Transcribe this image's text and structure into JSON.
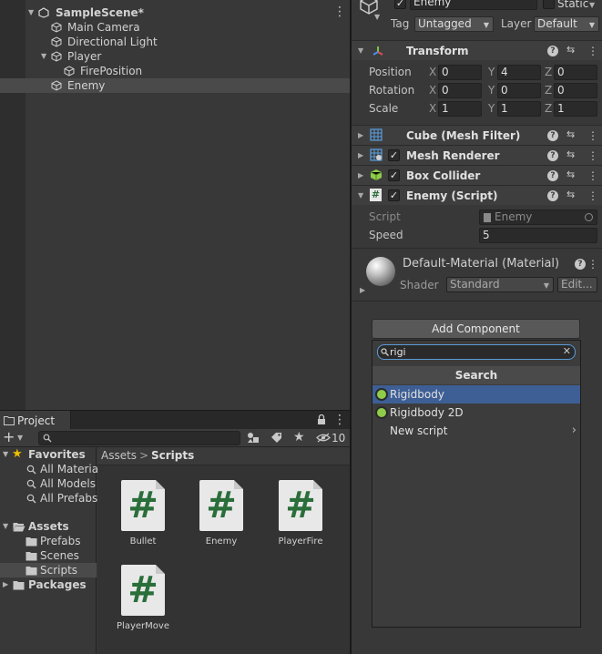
{
  "hierarchy": {
    "scene_name": "SampleScene*",
    "items": [
      {
        "label": "Main Camera"
      },
      {
        "label": "Directional Light"
      },
      {
        "label": "Player"
      },
      {
        "label": "FirePosition"
      },
      {
        "label": "Enemy"
      }
    ]
  },
  "project": {
    "tab_label": "Project",
    "hidden_count": "10",
    "search_placeholder": "",
    "tree": {
      "favorites": "Favorites",
      "fav_items": [
        "All Materia",
        "All Models",
        "All Prefabs"
      ],
      "assets": "Assets",
      "asset_items": [
        "Prefabs",
        "Scenes",
        "Scripts"
      ],
      "packages": "Packages"
    },
    "breadcrumb": {
      "root": "Assets",
      "sep": ">",
      "current": "Scripts"
    },
    "files": [
      {
        "name": "Bullet",
        "glyph": "#"
      },
      {
        "name": "Enemy",
        "glyph": "#"
      },
      {
        "name": "PlayerFire",
        "glyph": "#"
      },
      {
        "name": "PlayerMove",
        "glyph": "#"
      }
    ]
  },
  "inspector": {
    "object_name": "Enemy",
    "static_label": "Static",
    "tag_label": "Tag",
    "tag_value": "Untagged",
    "layer_label": "Layer",
    "layer_value": "Default",
    "transform": {
      "title": "Transform",
      "rows": [
        {
          "label": "Position",
          "x": "0",
          "y": "4",
          "z": "0"
        },
        {
          "label": "Rotation",
          "x": "0",
          "y": "0",
          "z": "0"
        },
        {
          "label": "Scale",
          "x": "1",
          "y": "1",
          "z": "1"
        }
      ],
      "axes": [
        "X",
        "Y",
        "Z"
      ]
    },
    "components": [
      {
        "title": "Cube (Mesh Filter)"
      },
      {
        "title": "Mesh Renderer"
      },
      {
        "title": "Box Collider"
      },
      {
        "title": "Enemy (Script)"
      }
    ],
    "script": {
      "script_label": "Script",
      "script_value": "Enemy",
      "speed_label": "Speed",
      "speed_value": "5"
    },
    "material": {
      "name": "Default-Material (Material)",
      "shader_label": "Shader",
      "shader_value": "Standard",
      "edit_label": "Edit..."
    },
    "add_component_label": "Add Component",
    "popup": {
      "search_value": "rigi",
      "header": "Search",
      "items": [
        {
          "label": "Rigidbody"
        },
        {
          "label": "Rigidbody 2D"
        },
        {
          "label": "New script"
        }
      ]
    }
  },
  "colors": {
    "selection": "#3e5f95",
    "script_green": "#2a6e3a",
    "rigidbody_icon": "#8fcc4a"
  }
}
